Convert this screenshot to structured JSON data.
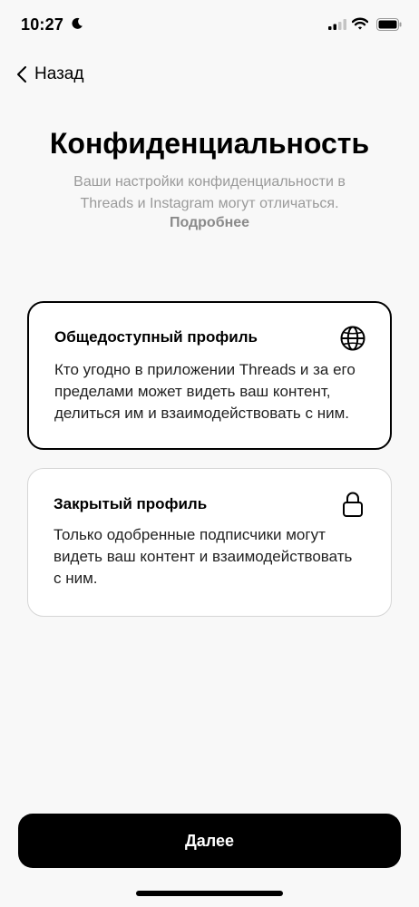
{
  "status_bar": {
    "time": "10:27",
    "icons": [
      "moon-icon",
      "cellular-signal-icon",
      "wifi-icon",
      "battery-icon"
    ]
  },
  "nav": {
    "back_label": "Назад",
    "back_icon": "chevron-left-icon"
  },
  "header": {
    "title": "Конфиденциальность",
    "subtitle": "Ваши настройки конфиденциальности в Threads и Instagram могут отличаться.",
    "more_link": "Подробнее"
  },
  "options": [
    {
      "title": "Общедоступный профиль",
      "description": "Кто угодно в приложении Threads и за его пределами может видеть ваш контент, делиться им и взаимодействовать с ним.",
      "icon": "globe-icon",
      "selected": true
    },
    {
      "title": "Закрытый профиль",
      "description": "Только одобренные подписчики могут видеть ваш контент и взаимодействовать с ним.",
      "icon": "lock-icon",
      "selected": false
    }
  ],
  "footer": {
    "next_label": "Далее"
  },
  "colors": {
    "background": "#f8f8f8",
    "primary": "#000000",
    "muted_text": "#9a9a9a",
    "card_border_unselected": "#d6d6d6"
  }
}
